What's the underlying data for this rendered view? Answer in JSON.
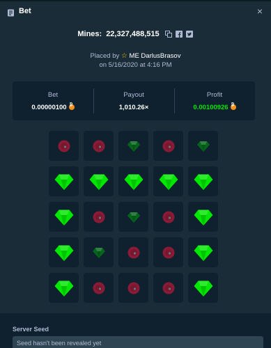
{
  "header": {
    "title": "Bet",
    "close_symbol": "×"
  },
  "game": {
    "mines_label": "Mines:",
    "bet_id": "22,327,488,515",
    "placed_by_prefix": "Placed by",
    "user": "ME DarlusBrasov",
    "placed_on": "on 5/16/2020 at 4:16 PM"
  },
  "stats": {
    "bet": {
      "label": "Bet",
      "value": "0.00000100",
      "currency_icon": "btc-icon"
    },
    "payout": {
      "label": "Payout",
      "value": "1,010.26×"
    },
    "profit": {
      "label": "Profit",
      "value": "0.00100926",
      "currency_icon": "btc-icon"
    }
  },
  "board": {
    "rows": [
      [
        "mine",
        "mine",
        "gem-dim",
        "mine",
        "gem-dim"
      ],
      [
        "gem",
        "gem",
        "gem",
        "gem",
        "gem"
      ],
      [
        "gem",
        "mine",
        "gem-dim",
        "mine",
        "gem"
      ],
      [
        "gem",
        "gem-dim",
        "mine",
        "mine",
        "gem"
      ],
      [
        "gem",
        "mine",
        "mine",
        "mine",
        "gem"
      ]
    ]
  },
  "server_seed": {
    "label": "Server Seed",
    "placeholder": "Seed hasn't been revealed yet"
  },
  "colors": {
    "background": "#1a2c38",
    "panel": "#0f212e",
    "gem": "#00e701",
    "gem_dim": "#05651c",
    "mine": "#8a1b36",
    "profit": "#00e701",
    "star": "#f5c400"
  }
}
